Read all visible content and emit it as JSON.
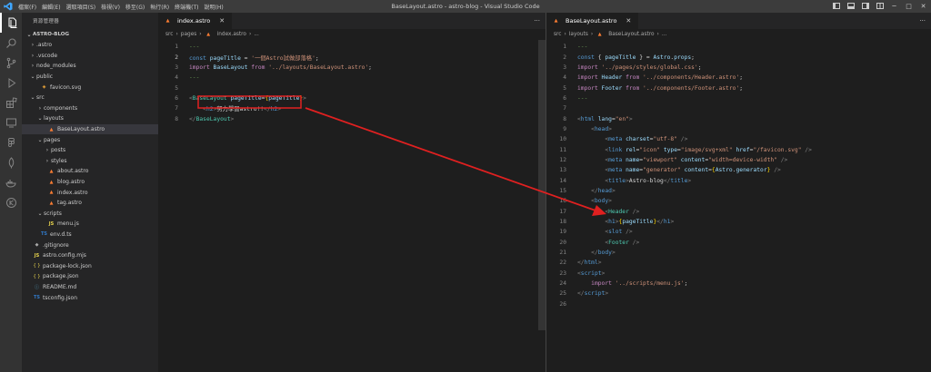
{
  "window": {
    "title": "BaseLayout.astro - astro-blog - Visual Studio Code",
    "menu": [
      "檔案(F)",
      "編輯(E)",
      "選取項目(S)",
      "檢視(V)",
      "移至(G)",
      "執行(R)",
      "終端機(T)",
      "說明(H)"
    ]
  },
  "sidebar": {
    "header": "資源管理器",
    "root": "ASTRO-BLOG",
    "tree": [
      {
        "label": ".astro",
        "depth": 1,
        "kind": "folder",
        "open": false
      },
      {
        "label": ".vscode",
        "depth": 1,
        "kind": "folder",
        "open": false
      },
      {
        "label": "node_modules",
        "depth": 1,
        "kind": "folder",
        "open": false
      },
      {
        "label": "public",
        "depth": 1,
        "kind": "folder",
        "open": true
      },
      {
        "label": "favicon.svg",
        "depth": 2,
        "kind": "svg"
      },
      {
        "label": "src",
        "depth": 1,
        "kind": "folder",
        "open": true
      },
      {
        "label": "components",
        "depth": 2,
        "kind": "folder",
        "open": false
      },
      {
        "label": "layouts",
        "depth": 2,
        "kind": "folder",
        "open": true
      },
      {
        "label": "BaseLayout.astro",
        "depth": 3,
        "kind": "astro",
        "selected": true
      },
      {
        "label": "pages",
        "depth": 2,
        "kind": "folder",
        "open": true
      },
      {
        "label": "posts",
        "depth": 3,
        "kind": "folder",
        "open": false
      },
      {
        "label": "styles",
        "depth": 3,
        "kind": "folder",
        "open": false
      },
      {
        "label": "about.astro",
        "depth": 3,
        "kind": "astro"
      },
      {
        "label": "blog.astro",
        "depth": 3,
        "kind": "astro"
      },
      {
        "label": "index.astro",
        "depth": 3,
        "kind": "astro"
      },
      {
        "label": "tag.astro",
        "depth": 3,
        "kind": "astro"
      },
      {
        "label": "scripts",
        "depth": 2,
        "kind": "folder",
        "open": true
      },
      {
        "label": "menu.js",
        "depth": 3,
        "kind": "js"
      },
      {
        "label": "env.d.ts",
        "depth": 2,
        "kind": "ts"
      },
      {
        "label": ".gitignore",
        "depth": 1,
        "kind": "git"
      },
      {
        "label": "astro.config.mjs",
        "depth": 1,
        "kind": "js"
      },
      {
        "label": "package-lock.json",
        "depth": 1,
        "kind": "json"
      },
      {
        "label": "package.json",
        "depth": 1,
        "kind": "json"
      },
      {
        "label": "README.md",
        "depth": 1,
        "kind": "info"
      },
      {
        "label": "tsconfig.json",
        "depth": 1,
        "kind": "ts"
      }
    ]
  },
  "left_editor": {
    "tab": "index.astro",
    "breadcrumb": [
      "src",
      "pages",
      "index.astro",
      "..."
    ],
    "lines": [
      [
        [
          "---",
          "c-com"
        ]
      ],
      [
        [
          "const ",
          "c-kw"
        ],
        [
          "pageTitle",
          "c-var"
        ],
        [
          " = ",
          "c-plain"
        ],
        [
          "'一個Astro試做部落格'",
          "c-str"
        ],
        [
          ";",
          "c-plain"
        ]
      ],
      [
        [
          "import ",
          "c-kw2"
        ],
        [
          "BaseLayout",
          "c-var"
        ],
        [
          " from ",
          "c-kw2"
        ],
        [
          "'../layouts/BaseLayout.astro'",
          "c-str"
        ],
        [
          ";",
          "c-plain"
        ]
      ],
      [
        [
          "---",
          "c-com"
        ]
      ],
      [],
      [
        [
          "<",
          "c-brk"
        ],
        [
          "BaseLayout",
          "c-cls"
        ],
        [
          " pageTitle",
          "c-attr"
        ],
        [
          "=",
          "c-plain"
        ],
        [
          "{",
          "c-bracey"
        ],
        [
          "pageTitle",
          "c-var"
        ],
        [
          "}",
          "c-bracey"
        ],
        [
          ">",
          "c-brk"
        ]
      ],
      [
        [
          "    ",
          "c-plain"
        ],
        [
          "<",
          "c-brk"
        ],
        [
          "h2",
          "c-tag"
        ],
        [
          ">",
          "c-brk"
        ],
        [
          "努力學習astro!!",
          "c-plain"
        ],
        [
          "</",
          "c-brk"
        ],
        [
          "h2",
          "c-tag"
        ],
        [
          ">",
          "c-brk"
        ]
      ],
      [
        [
          "</",
          "c-brk"
        ],
        [
          "BaseLayout",
          "c-cls"
        ],
        [
          ">",
          "c-brk"
        ]
      ]
    ]
  },
  "right_editor": {
    "tab": "BaseLayout.astro",
    "breadcrumb": [
      "src",
      "layouts",
      "BaseLayout.astro",
      "..."
    ],
    "lines": [
      [
        [
          "---",
          "c-com"
        ]
      ],
      [
        [
          "const ",
          "c-kw"
        ],
        [
          "{ ",
          "c-plain"
        ],
        [
          "pageTitle",
          "c-var"
        ],
        [
          " } = ",
          "c-plain"
        ],
        [
          "Astro",
          "c-var"
        ],
        [
          ".",
          "c-plain"
        ],
        [
          "props",
          "c-var"
        ],
        [
          ";",
          "c-plain"
        ]
      ],
      [
        [
          "import ",
          "c-kw2"
        ],
        [
          "'../pages/styles/global.css'",
          "c-str"
        ],
        [
          ";",
          "c-plain"
        ]
      ],
      [
        [
          "import ",
          "c-kw2"
        ],
        [
          "Header",
          "c-var"
        ],
        [
          " from ",
          "c-kw2"
        ],
        [
          "'../components/Header.astro'",
          "c-str"
        ],
        [
          ";",
          "c-plain"
        ]
      ],
      [
        [
          "import ",
          "c-kw2"
        ],
        [
          "Footer",
          "c-var"
        ],
        [
          " from ",
          "c-kw2"
        ],
        [
          "'../components/Footer.astro'",
          "c-str"
        ],
        [
          ";",
          "c-plain"
        ]
      ],
      [
        [
          "---",
          "c-com"
        ]
      ],
      [],
      [
        [
          "<",
          "c-brk"
        ],
        [
          "html",
          "c-tag"
        ],
        [
          " lang",
          "c-attr"
        ],
        [
          "=",
          "c-plain"
        ],
        [
          "\"en\"",
          "c-str"
        ],
        [
          ">",
          "c-brk"
        ]
      ],
      [
        [
          "    ",
          "c-plain"
        ],
        [
          "<",
          "c-brk"
        ],
        [
          "head",
          "c-tag"
        ],
        [
          ">",
          "c-brk"
        ]
      ],
      [
        [
          "        ",
          "c-plain"
        ],
        [
          "<",
          "c-brk"
        ],
        [
          "meta",
          "c-tag"
        ],
        [
          " charset",
          "c-attr"
        ],
        [
          "=",
          "c-plain"
        ],
        [
          "\"utf-8\"",
          "c-str"
        ],
        [
          " />",
          "c-brk"
        ]
      ],
      [
        [
          "        ",
          "c-plain"
        ],
        [
          "<",
          "c-brk"
        ],
        [
          "link",
          "c-tag"
        ],
        [
          " rel",
          "c-attr"
        ],
        [
          "=",
          "c-plain"
        ],
        [
          "\"icon\"",
          "c-str"
        ],
        [
          " type",
          "c-attr"
        ],
        [
          "=",
          "c-plain"
        ],
        [
          "\"image/svg+xml\"",
          "c-str"
        ],
        [
          " href",
          "c-attr"
        ],
        [
          "=",
          "c-plain"
        ],
        [
          "\"/favicon.svg\"",
          "c-str"
        ],
        [
          " />",
          "c-brk"
        ]
      ],
      [
        [
          "        ",
          "c-plain"
        ],
        [
          "<",
          "c-brk"
        ],
        [
          "meta",
          "c-tag"
        ],
        [
          " name",
          "c-attr"
        ],
        [
          "=",
          "c-plain"
        ],
        [
          "\"viewport\"",
          "c-str"
        ],
        [
          " content",
          "c-attr"
        ],
        [
          "=",
          "c-plain"
        ],
        [
          "\"width=device-width\"",
          "c-str"
        ],
        [
          " />",
          "c-brk"
        ]
      ],
      [
        [
          "        ",
          "c-plain"
        ],
        [
          "<",
          "c-brk"
        ],
        [
          "meta",
          "c-tag"
        ],
        [
          " name",
          "c-attr"
        ],
        [
          "=",
          "c-plain"
        ],
        [
          "\"generator\"",
          "c-str"
        ],
        [
          " content",
          "c-attr"
        ],
        [
          "=",
          "c-plain"
        ],
        [
          "{",
          "c-bracey"
        ],
        [
          "Astro",
          "c-var"
        ],
        [
          ".",
          "c-plain"
        ],
        [
          "generator",
          "c-var"
        ],
        [
          "}",
          "c-bracey"
        ],
        [
          " />",
          "c-brk"
        ]
      ],
      [
        [
          "        ",
          "c-plain"
        ],
        [
          "<",
          "c-brk"
        ],
        [
          "title",
          "c-tag"
        ],
        [
          ">",
          "c-brk"
        ],
        [
          "Astro-blog",
          "c-plain"
        ],
        [
          "</",
          "c-brk"
        ],
        [
          "title",
          "c-tag"
        ],
        [
          ">",
          "c-brk"
        ]
      ],
      [
        [
          "    ",
          "c-plain"
        ],
        [
          "</",
          "c-brk"
        ],
        [
          "head",
          "c-tag"
        ],
        [
          ">",
          "c-brk"
        ]
      ],
      [
        [
          "    ",
          "c-plain"
        ],
        [
          "<",
          "c-brk"
        ],
        [
          "body",
          "c-tag"
        ],
        [
          ">",
          "c-brk"
        ]
      ],
      [
        [
          "        ",
          "c-plain"
        ],
        [
          "<",
          "c-brk"
        ],
        [
          "Header",
          "c-cls"
        ],
        [
          " />",
          "c-brk"
        ]
      ],
      [
        [
          "        ",
          "c-plain"
        ],
        [
          "<",
          "c-brk"
        ],
        [
          "h1",
          "c-tag"
        ],
        [
          ">",
          "c-brk"
        ],
        [
          "{",
          "c-bracey"
        ],
        [
          "pageTitle",
          "c-var"
        ],
        [
          "}",
          "c-bracey"
        ],
        [
          "</",
          "c-brk"
        ],
        [
          "h1",
          "c-tag"
        ],
        [
          ">",
          "c-brk"
        ]
      ],
      [
        [
          "        ",
          "c-plain"
        ],
        [
          "<",
          "c-brk"
        ],
        [
          "slot",
          "c-tag"
        ],
        [
          " />",
          "c-brk"
        ]
      ],
      [
        [
          "        ",
          "c-plain"
        ],
        [
          "<",
          "c-brk"
        ],
        [
          "Footer",
          "c-cls"
        ],
        [
          " />",
          "c-brk"
        ]
      ],
      [
        [
          "    ",
          "c-plain"
        ],
        [
          "</",
          "c-brk"
        ],
        [
          "body",
          "c-tag"
        ],
        [
          ">",
          "c-brk"
        ]
      ],
      [
        [
          "</",
          "c-brk"
        ],
        [
          "html",
          "c-tag"
        ],
        [
          ">",
          "c-brk"
        ]
      ],
      [
        [
          "<",
          "c-brk"
        ],
        [
          "script",
          "c-tag"
        ],
        [
          ">",
          "c-brk"
        ]
      ],
      [
        [
          "    ",
          "c-plain"
        ],
        [
          "import ",
          "c-kw2"
        ],
        [
          "'../scripts/menu.js'",
          "c-str"
        ],
        [
          ";",
          "c-plain"
        ]
      ],
      [
        [
          "</",
          "c-brk"
        ],
        [
          "script",
          "c-tag"
        ],
        [
          ">",
          "c-brk"
        ]
      ],
      []
    ]
  },
  "colors": {
    "annotation": "#e02020",
    "accent": "#3ea6ff"
  }
}
